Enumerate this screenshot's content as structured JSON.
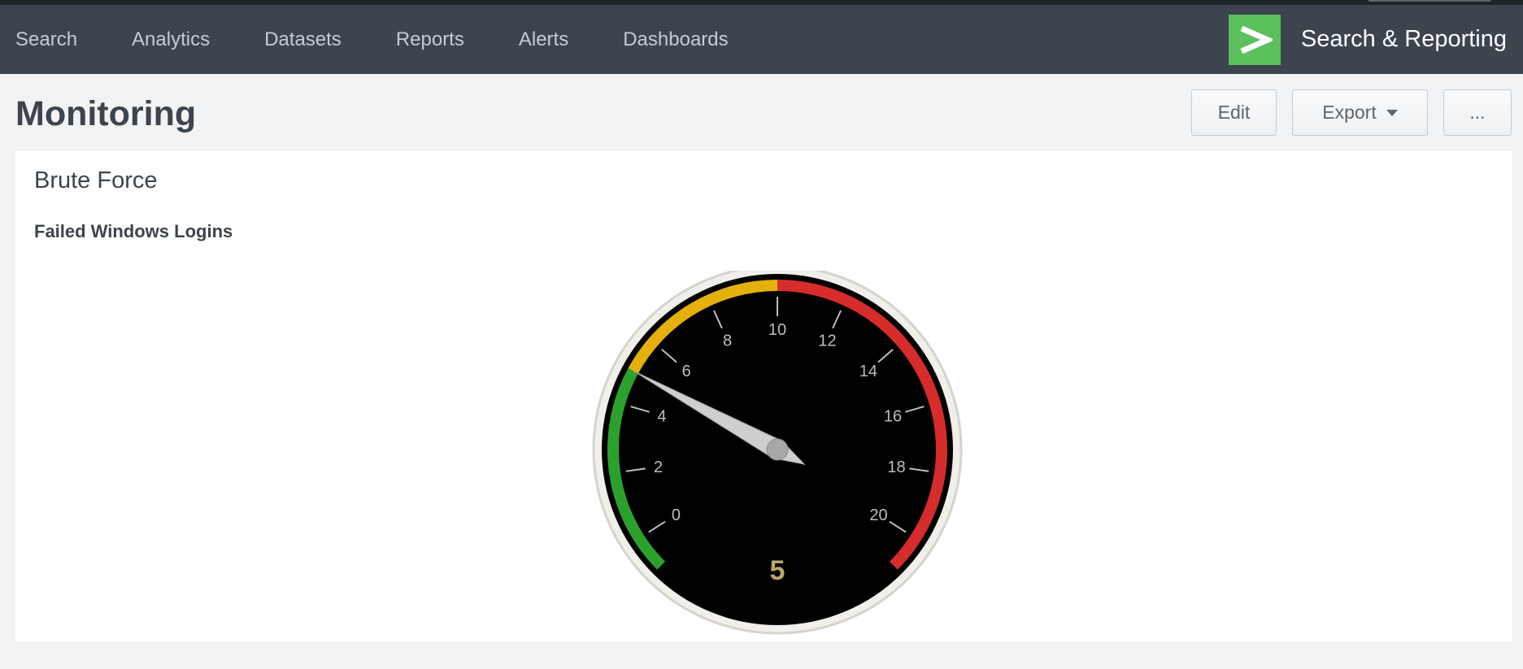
{
  "nav": {
    "items": [
      {
        "label": "Search"
      },
      {
        "label": "Analytics"
      },
      {
        "label": "Datasets"
      },
      {
        "label": "Reports"
      },
      {
        "label": "Alerts"
      },
      {
        "label": "Dashboards"
      }
    ]
  },
  "brand": {
    "title": "Search & Reporting",
    "logo_icon": "chevron-right-icon",
    "logo_color": "#5cc05c"
  },
  "page": {
    "title": "Monitoring"
  },
  "toolbar": {
    "edit_label": "Edit",
    "export_label": "Export",
    "more_label": "..."
  },
  "panel": {
    "title": "Brute Force",
    "viz_title": "Failed Windows Logins"
  },
  "gauge": {
    "value": 5,
    "value_label": "5",
    "min": -1,
    "max": 21,
    "tick_labels": [
      0,
      2,
      4,
      6,
      8,
      10,
      12,
      14,
      16,
      18,
      20
    ],
    "ranges": [
      {
        "from": -1,
        "to": 5,
        "color": "#2ca02c"
      },
      {
        "from": 5,
        "to": 10,
        "color": "#e5b00b"
      },
      {
        "from": 10,
        "to": 21,
        "color": "#d62c2c"
      }
    ],
    "value_color": "#b8a96a"
  }
}
